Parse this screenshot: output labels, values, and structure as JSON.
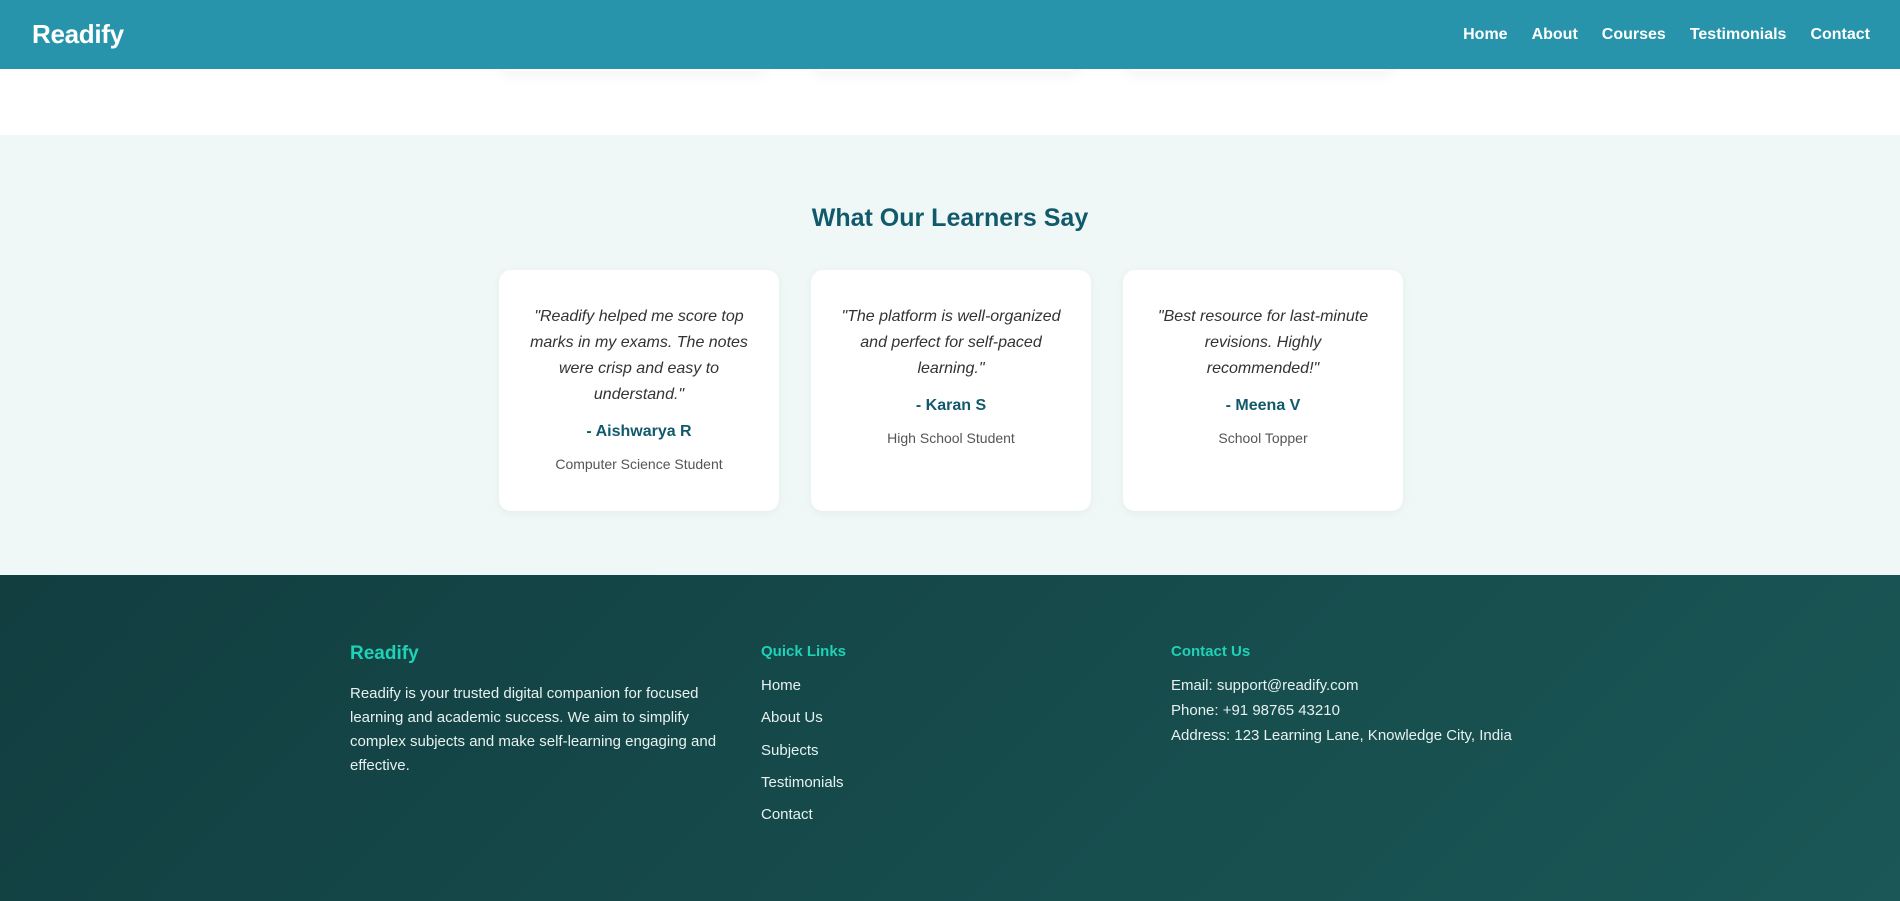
{
  "nav": {
    "brand": "Readify",
    "links": [
      "Home",
      "About",
      "Courses",
      "Testimonials",
      "Contact"
    ]
  },
  "testimonials": {
    "title": "What Our Learners Say",
    "cards": [
      {
        "quote": "\"Readify helped me score top marks in my exams. The notes were crisp and easy to understand.\"",
        "author": "- Aishwarya R",
        "role": "Computer Science Student"
      },
      {
        "quote": "\"The platform is well-organized and perfect for self-paced learning.\"",
        "author": "- Karan S",
        "role": "High School Student"
      },
      {
        "quote": "\"Best resource for last-minute revisions. Highly recommended!\"",
        "author": "- Meena V",
        "role": "School Topper"
      }
    ]
  },
  "footer": {
    "brand": "Readify",
    "description": "Readify is your trusted digital companion for focused learning and academic success. We aim to simplify complex subjects and make self-learning engaging and effective.",
    "quick_links_title": "Quick Links",
    "quick_links": [
      "Home",
      "About Us",
      "Subjects",
      "Testimonials",
      "Contact"
    ],
    "contact_title": "Contact Us",
    "contact": {
      "email": "Email: support@readify.com",
      "phone": "Phone: +91 98765 43210",
      "address": "Address: 123 Learning Lane, Knowledge City, India"
    }
  }
}
